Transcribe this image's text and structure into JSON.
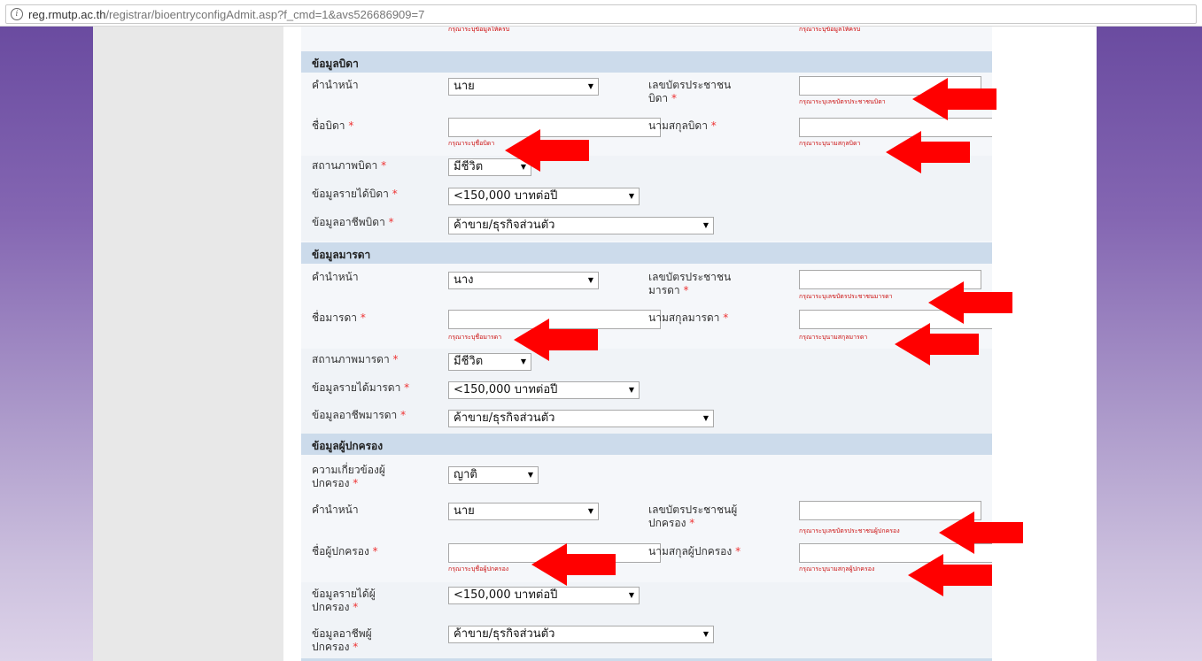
{
  "browser": {
    "url_host": "reg.rmutp.ac.th",
    "url_path": "/registrar/bioentryconfigAdmit.asp?f_cmd=1&avs526686909=7"
  },
  "top_cut": {
    "left_text": "กรุณาระบุข้อมูลให้ครบ",
    "right_text": "กรุณาระบุข้อมูลให้ครบ"
  },
  "father": {
    "header": "ข้อมูลบิดา",
    "prefix_label": "คำนำหน้า",
    "prefix_value": "นาย",
    "id_label_1": "เลขบัตรประชาชน",
    "id_label_2": "บิดา",
    "id_error": "กรุณาระบุเลขบัตรประชาชนบิดา",
    "name_label": "ชื่อบิดา",
    "name_error": "กรุณาระบุชื่อบิดา",
    "surname_label": "นามสกุลบิดา",
    "surname_error": "กรุณาระบุนามสกุลบิดา",
    "status_label": "สถานภาพบิดา",
    "status_value": "มีชีวิต",
    "income_label": "ข้อมูลรายได้บิดา",
    "income_value": "<150,000 บาทต่อปี",
    "job_label": "ข้อมูลอาชีพบิดา",
    "job_value": "ค้าขาย/ธุรกิจส่วนตัว"
  },
  "mother": {
    "header": "ข้อมูลมารดา",
    "prefix_label": "คำนำหน้า",
    "prefix_value": "นาง",
    "id_label_1": "เลขบัตรประชาชน",
    "id_label_2": "มารดา",
    "id_error": "กรุณาระบุเลขบัตรประชาชนมารดา",
    "name_label": "ชื่อมารดา",
    "name_error": "กรุณาระบุชื่อมารดา",
    "surname_label": "นามสกุลมารดา",
    "surname_error": "กรุณาระบุนามสกุลมารดา",
    "status_label": "สถานภาพมารดา",
    "status_value": "มีชีวิต",
    "income_label": "ข้อมูลรายได้มารดา",
    "income_value": "<150,000 บาทต่อปี",
    "job_label": "ข้อมูลอาชีพมารดา",
    "job_value": "ค้าขาย/ธุรกิจส่วนตัว"
  },
  "guardian": {
    "header": "ข้อมูลผู้ปกครอง",
    "relation_label_1": "ความเกี่ยวข้องผู้",
    "relation_label_2": "ปกครอง",
    "relation_value": "ญาติ",
    "prefix_label": "คำนำหน้า",
    "prefix_value": "นาย",
    "id_label_1": "เลขบัตรประชาชนผู้",
    "id_label_2": "ปกครอง",
    "id_error": "กรุณาระบุเลขบัตรประชาชนผู้ปกครอง",
    "name_label": "ชื่อผู้ปกครอง",
    "name_error": "กรุณาระบุชื่อผู้ปกครอง",
    "surname_label": "นามสกุลผู้ปกครอง",
    "surname_error": "กรุณาระบุนามสกุลผู้ปกครอง",
    "income_label_1": "ข้อมูลรายได้ผู้",
    "income_label_2": "ปกครอง",
    "income_value": "<150,000 บาทต่อปี",
    "job_label_1": "ข้อมูลอาชีพผู้",
    "job_label_2": "ปกครอง",
    "job_value": "ค้าขาย/ธุรกิจส่วนตัว"
  },
  "required_mark": "*",
  "colors": {
    "annotation_arrow": "#ff0000",
    "error_text": "#cc1111",
    "section_header": "#ccdbeb"
  }
}
